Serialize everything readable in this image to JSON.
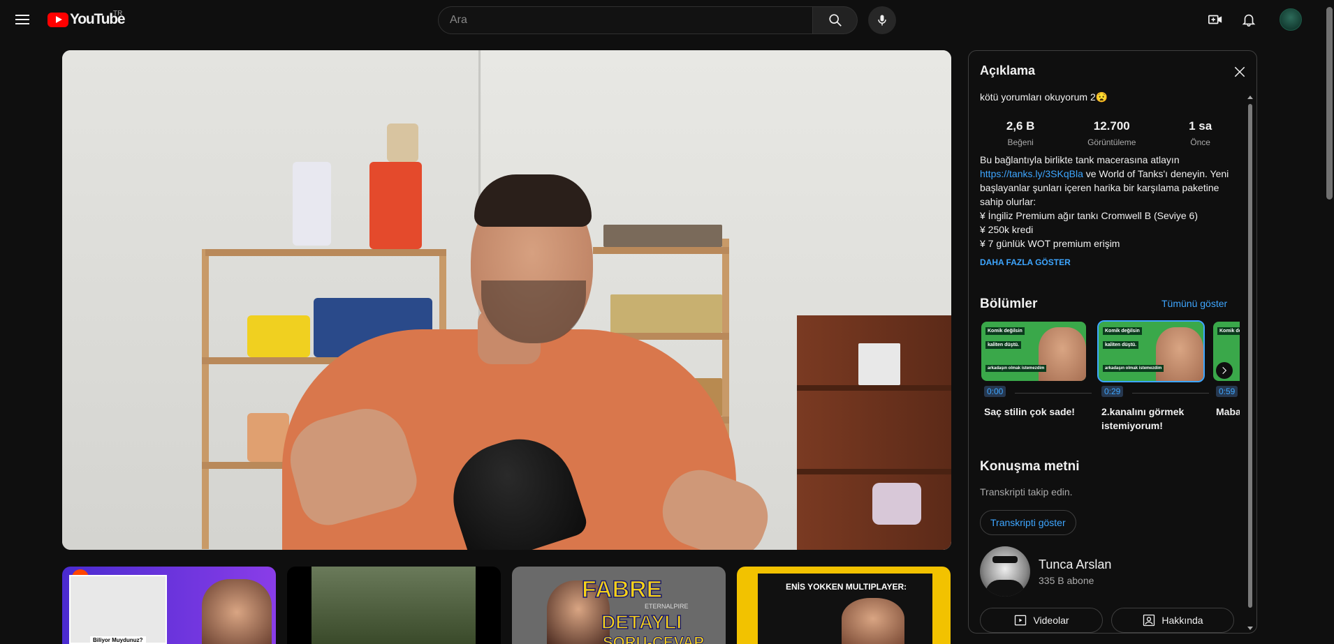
{
  "header": {
    "logo_text": "YouTube",
    "country_code": "TR",
    "search_placeholder": "Ara",
    "icons": [
      "menu-icon",
      "search-icon",
      "mic-icon",
      "create-video-icon",
      "bell-icon",
      "account-avatar"
    ]
  },
  "description_panel": {
    "title": "Açıklama",
    "video_title": "kötü yorumları okuyorum 2😧",
    "stats": [
      {
        "value": "2,6 B",
        "label": "Beğeni"
      },
      {
        "value": "12.700",
        "label": "Görüntüleme"
      },
      {
        "value": "1 sa",
        "label": "Önce"
      }
    ],
    "description_line1": "Bu bağlantıyla birlikte tank macerasına atlayın",
    "link": "https://tanks.ly/3SKqBla",
    "description_after_link": " ve World of Tanks'ı deneyin. Yeni başlayanlar şunları içeren harika bir karşılama paketine sahip olurlar:",
    "bullets": [
      "¥ İngiliz Premium ağır tankı Cromwell B (Seviye 6)",
      "¥ 250k kredi",
      "¥ 7 günlük WOT premium erişim"
    ],
    "show_more": "DAHA FAZLA GÖSTER",
    "chapters_title": "Bölümler",
    "show_all": "Tümünü göster",
    "chapter_thumb_texts": [
      "Komik değilsin",
      "kaliten düştü.",
      "arkadaşın olmak istemezdim"
    ],
    "chapters": [
      {
        "time": "0:00",
        "title": "Saç stilin çok sade!"
      },
      {
        "time": "0:29",
        "title": "2.kanalını görmek istemiyorum!"
      },
      {
        "time": "0:59",
        "title": "Mabad uydurı"
      }
    ],
    "transcript_title": "Konuşma metni",
    "transcript_sub": "Transkripti takip edin.",
    "transcript_button": "Transkripti göster",
    "channel_name": "Tunca Arslan",
    "channel_subs": "335 B abone",
    "videos_button": "Videolar",
    "about_button": "Hakkında"
  },
  "recommendations": [
    {
      "thumb_text": "Biliyor Muydunuz?",
      "accent": "#6a3de8"
    },
    {
      "thumb_text": "",
      "accent": "#4a5a3a"
    },
    {
      "thumb_text_line1": "FABRE",
      "thumb_text_line2": "DETAYLI",
      "thumb_text_line3": "SORU-CEVAP",
      "thumb_text_small": "ETERNALPIRE",
      "accent": "#f7d21a"
    },
    {
      "thumb_text": "ENİS YOKKEN MULTIPLAYER:",
      "accent": "#f2c200"
    }
  ]
}
